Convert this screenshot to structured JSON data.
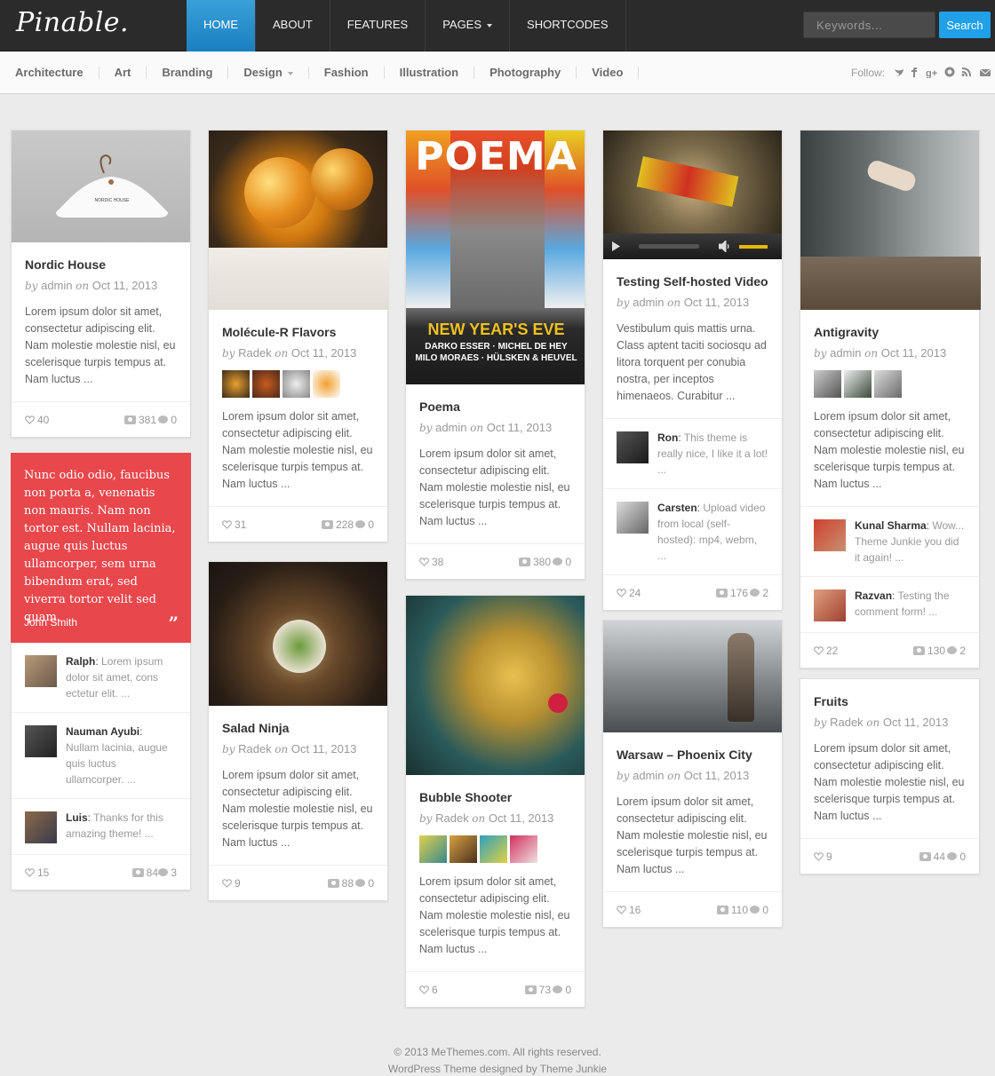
{
  "brand": {
    "logo": "Pinable."
  },
  "nav": {
    "items": [
      {
        "label": "HOME"
      },
      {
        "label": "ABOUT"
      },
      {
        "label": "FEATURES"
      },
      {
        "label": "PAGES"
      },
      {
        "label": "SHORTCODES"
      }
    ]
  },
  "search": {
    "placeholder": "Keywords...",
    "button": "Search"
  },
  "categories": [
    "Architecture",
    "Art",
    "Branding",
    "Design",
    "Fashion",
    "Illustration",
    "Photography",
    "Video"
  ],
  "follow_label": "Follow:",
  "social": [
    "twitter-icon",
    "facebook-icon",
    "google-plus-icon",
    "pinterest-icon",
    "rss-icon",
    "email-icon"
  ],
  "colors": {
    "accent": "#1fa0e8",
    "quote_bg": "#e8474c",
    "topbar": "#2b2b2b"
  },
  "by": "by",
  "on": "on",
  "excerpt_default": "Lorem ipsum dolor sit amet, consectetur adipiscing elit. Nam molestie molestie nisl, eu scelerisque turpis tempus at. Nam luctus ...",
  "posts": {
    "nordic": {
      "title": "Nordic House",
      "author": "admin",
      "date": "Oct 11, 2013",
      "excerpt": "Lorem ipsum dolor sit amet, consectetur adipiscing elit. Nam molestie molestie nisl, eu scelerisque turpis tempus at. Nam luctus ...",
      "likes": "40",
      "views": "381",
      "comments": "0",
      "thumb_text": "NORDIC HOUSE"
    },
    "quote": {
      "text": "Nunc odio odio, faucibus non porta a, venenatis non mauris. Nam non tortor est. Nullam lacinia, augue quis luctus ullamcorper, sem urna bibendum erat, sed viverra tortor velit sed quam.",
      "author": "John Smith",
      "likes": "15",
      "views": "84",
      "comments": "3",
      "comment_list": [
        {
          "name": "Ralph",
          "text": "Lorem ipsum dolor sit amet, cons ectetur elit. ..."
        },
        {
          "name": "Nauman Ayubi",
          "text": "Nullam lacinia, augue quis luctus ullamcorper. ..."
        },
        {
          "name": "Luis",
          "text": "Thanks for this amazing theme! ..."
        }
      ]
    },
    "molecule": {
      "title": "Molécule-R Flavors",
      "author": "Radek",
      "date": "Oct 11, 2013",
      "excerpt": "Lorem ipsum dolor sit amet, consectetur adipiscing elit. Nam molestie molestie nisl, eu scelerisque turpis tempus at. Nam luctus ...",
      "likes": "31",
      "views": "228",
      "comments": "0"
    },
    "salad": {
      "title": "Salad Ninja",
      "author": "Radek",
      "date": "Oct 11, 2013",
      "excerpt": "Lorem ipsum dolor sit amet, consectetur adipiscing elit. Nam molestie molestie nisl, eu scelerisque turpis tempus at. Nam luctus ...",
      "likes": "9",
      "views": "88",
      "comments": "0"
    },
    "poema": {
      "title": "Poema",
      "author": "admin",
      "date": "Oct 11, 2013",
      "excerpt": "Lorem ipsum dolor sit amet, consectetur adipiscing elit. Nam molestie molestie nisl, eu scelerisque turpis tempus at. Nam luctus ...",
      "likes": "38",
      "views": "380",
      "comments": "0",
      "poster_title": "POEMA",
      "poster_sub": "NEW YEAR'S EVE",
      "poster_line1": "DARKO ESSER · MICHEL DE HEY",
      "poster_line2": "MILO MORAES · HÜLSKEN & HEUVEL"
    },
    "bubble": {
      "title": "Bubble Shooter",
      "author": "Radek",
      "date": "Oct 11, 2013",
      "excerpt": "Lorem ipsum dolor sit amet, consectetur adipiscing elit. Nam molestie molestie nisl, eu scelerisque turpis tempus at. Nam luctus ...",
      "likes": "6",
      "views": "73",
      "comments": "0"
    },
    "video": {
      "title": "Testing Self-hosted Video",
      "author": "admin",
      "date": "Oct 11, 2013",
      "excerpt": "Vestibulum quis mattis urna. Class aptent taciti sociosqu ad litora torquent per conubia nostra, per inceptos himenaeos. Curabitur ...",
      "likes": "24",
      "views": "176",
      "comments": "2",
      "comment_list": [
        {
          "name": "Ron",
          "text": "This theme is really nice, I like it a lot! ..."
        },
        {
          "name": "Carsten",
          "text": "Upload video from local (self-hosted): mp4, webm, ..."
        }
      ]
    },
    "warsaw": {
      "title": "Warsaw – Phoenix City",
      "author": "admin",
      "date": "Oct 11, 2013",
      "excerpt": "Lorem ipsum dolor sit amet, consectetur adipiscing elit. Nam molestie molestie nisl, eu scelerisque turpis tempus at. Nam luctus ...",
      "likes": "16",
      "views": "110",
      "comments": "0"
    },
    "antigravity": {
      "title": "Antigravity",
      "author": "admin",
      "date": "Oct 11, 2013",
      "excerpt": "Lorem ipsum dolor sit amet, consectetur adipiscing elit. Nam molestie molestie nisl, eu scelerisque turpis tempus at. Nam luctus ...",
      "likes": "22",
      "views": "130",
      "comments": "2",
      "comment_list": [
        {
          "name": "Kunal Sharma",
          "text": "Wow... Theme Junkie you did it again! ..."
        },
        {
          "name": "Razvan",
          "text": "Testing the comment form! ..."
        }
      ]
    },
    "fruits": {
      "title": "Fruits",
      "author": "Radek",
      "date": "Oct 11, 2013",
      "excerpt": "Lorem ipsum dolor sit amet, consectetur adipiscing elit. Nam molestie molestie nisl, eu scelerisque turpis tempus at. Nam luctus ...",
      "likes": "9",
      "views": "44",
      "comments": "0"
    }
  },
  "footer": {
    "line1": "© 2013 MeThemes.com. All rights reserved.",
    "line2": "WordPress Theme designed by Theme Junkie"
  }
}
